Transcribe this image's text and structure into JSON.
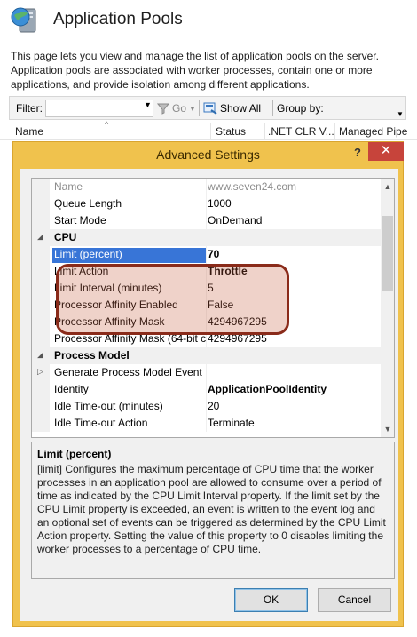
{
  "page": {
    "title": "Application Pools",
    "description": "This page lets you view and manage the list of application pools on the server. Application pools are associated with worker processes, contain one or more applications, and provide isolation among different applications."
  },
  "filter_bar": {
    "filter_label": "Filter:",
    "filter_value": "",
    "go_label": "Go",
    "show_all_label": "Show All",
    "group_by_label": "Group by:"
  },
  "columns": [
    "Name",
    "Status",
    ".NET CLR V...",
    "Managed Pipe"
  ],
  "dialog": {
    "title": "Advanced Settings",
    "help_label": "?",
    "close_label": "✕",
    "properties": [
      {
        "name": "Name",
        "value": "www.seven24.com",
        "style": "dim"
      },
      {
        "name": "Queue Length",
        "value": "1000"
      },
      {
        "name": "Start Mode",
        "value": "OnDemand"
      },
      {
        "name": "CPU",
        "value": "",
        "category": true
      },
      {
        "name": "Limit (percent)",
        "value": "70",
        "selected": true,
        "bold": true
      },
      {
        "name": "Limit Action",
        "value": "Throttle",
        "bold": true
      },
      {
        "name": "Limit Interval (minutes)",
        "value": "5"
      },
      {
        "name": "Processor Affinity Enabled",
        "value": "False"
      },
      {
        "name": "Processor Affinity Mask",
        "value": "4294967295"
      },
      {
        "name": "Processor Affinity Mask (64-bit c",
        "value": "4294967295"
      },
      {
        "name": "Process Model",
        "value": "",
        "category": true
      },
      {
        "name": "Generate Process Model Event L",
        "value": "",
        "collapsed": true
      },
      {
        "name": "Identity",
        "value": "ApplicationPoolIdentity",
        "bold": true
      },
      {
        "name": "Idle Time-out (minutes)",
        "value": "20"
      },
      {
        "name": "Idle Time-out Action",
        "value": "Terminate"
      }
    ],
    "description_title": "Limit (percent)",
    "description_text": "[limit] Configures the maximum percentage of CPU time that the worker processes in an application pool are allowed to consume over a period of time as indicated by the CPU Limit Interval property. If the limit set by the CPU Limit property is exceeded, an event is written to the event log and an optional set of events can be triggered as determined by the CPU Limit Action property. Setting the value of this property to 0 disables limiting the worker processes to a percentage of CPU time.",
    "ok_label": "OK",
    "cancel_label": "Cancel"
  },
  "colors": {
    "dialog_frame": "#f0c24d",
    "close_button": "#c7443b",
    "selection": "#3875d7",
    "highlight_border": "#8a2b1a"
  }
}
